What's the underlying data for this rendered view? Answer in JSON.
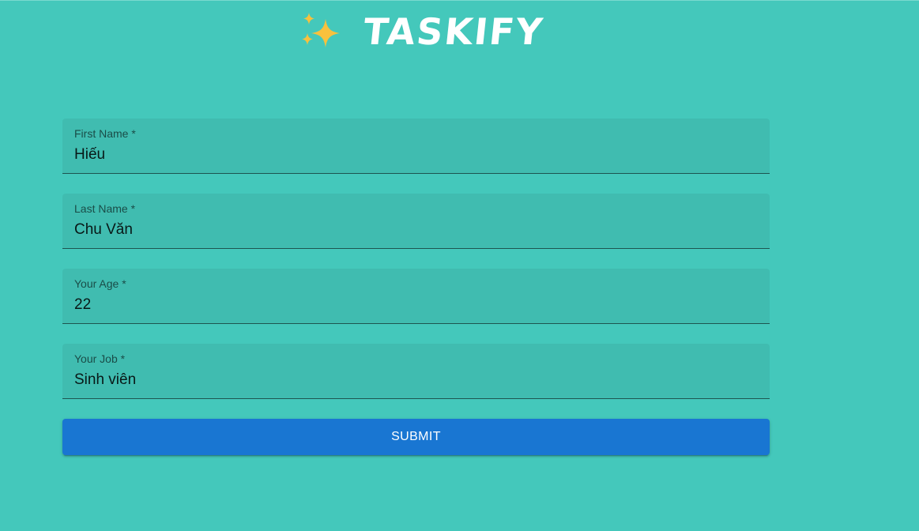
{
  "header": {
    "title": "TASKIFY",
    "logo_icon": "sparkles-icon"
  },
  "form": {
    "fields": [
      {
        "label": "First Name *",
        "value": "Hiếu"
      },
      {
        "label": "Last Name *",
        "value": "Chu Văn"
      },
      {
        "label": "Your Age *",
        "value": "22"
      },
      {
        "label": "Your Job *",
        "value": "Sinh viên"
      }
    ],
    "submit_label": "SUBMIT"
  },
  "colors": {
    "background": "#44c8bb",
    "button": "#1976d2",
    "sparkle": "#f8c13d"
  }
}
